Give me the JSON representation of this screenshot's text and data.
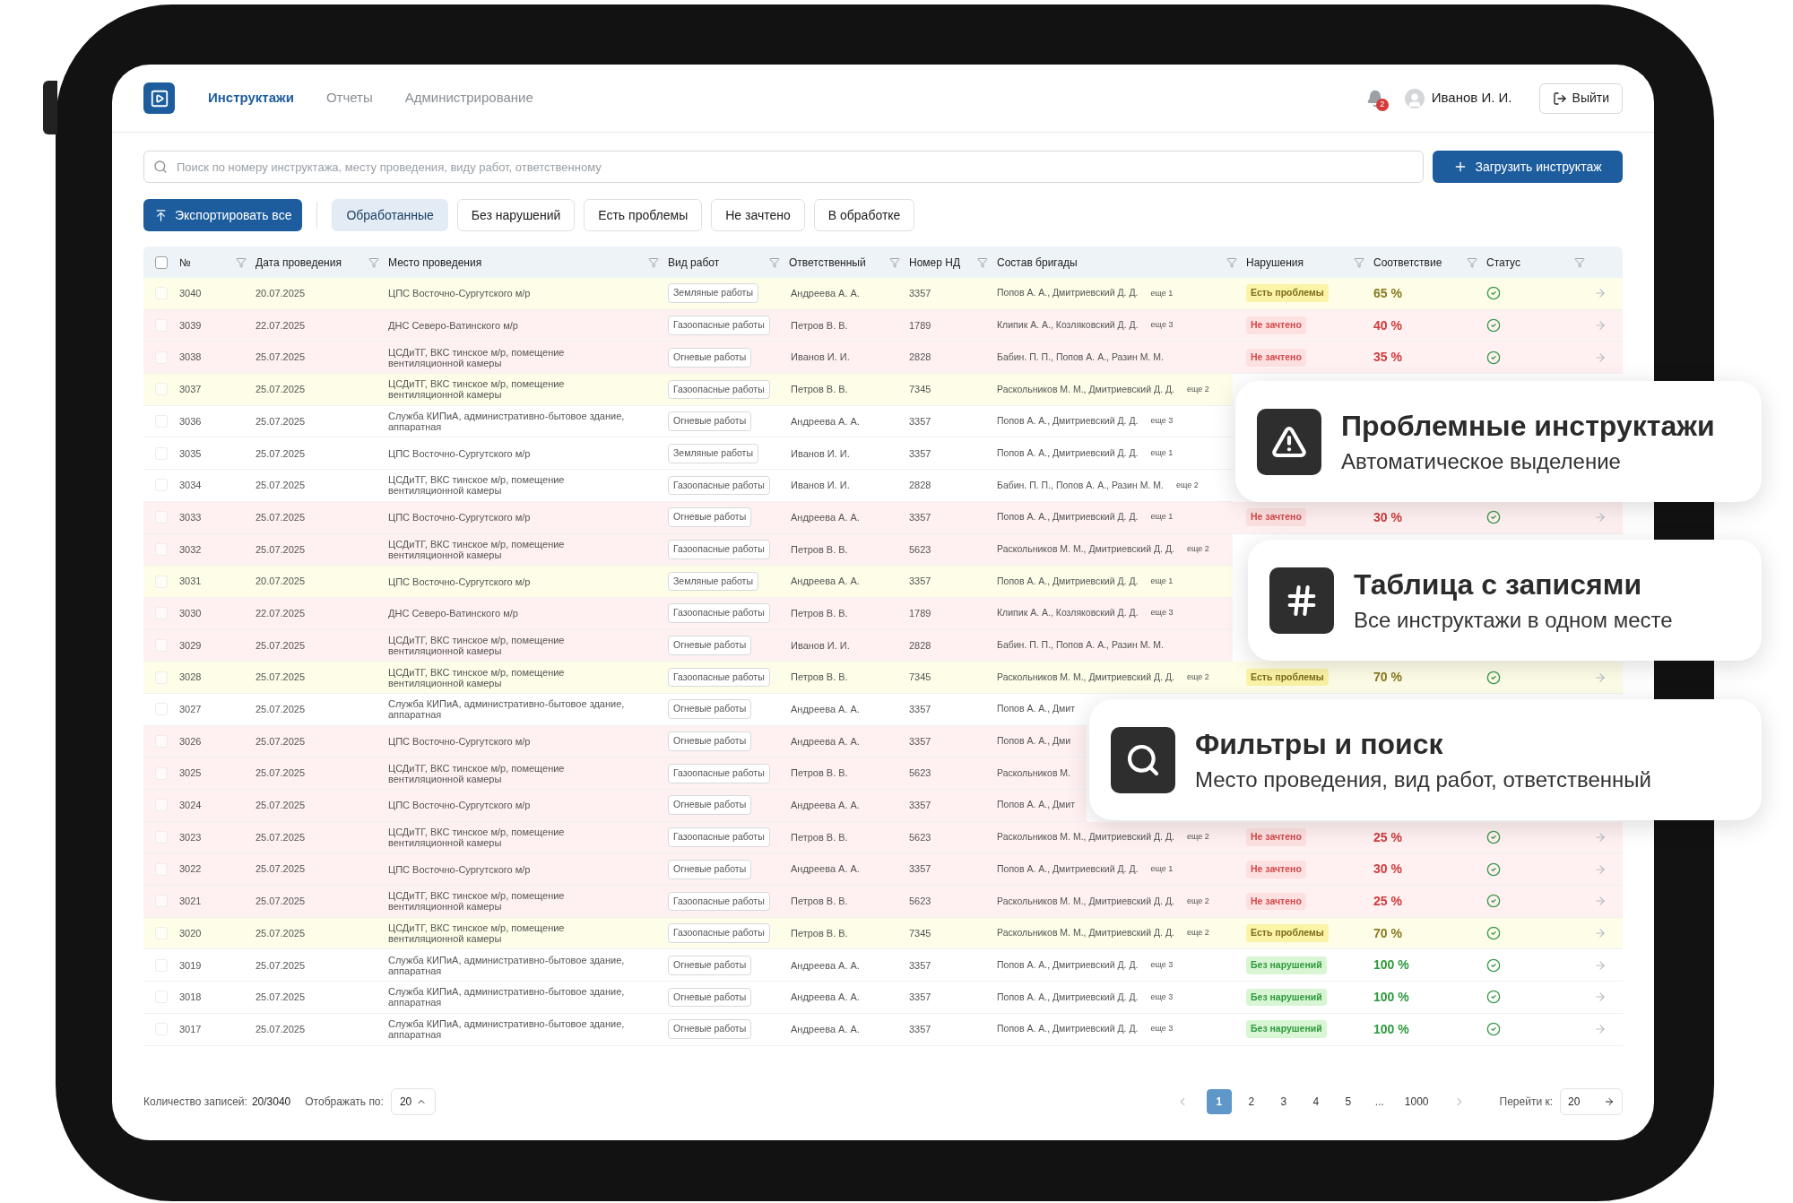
{
  "nav": {
    "tabs": [
      {
        "label": "Инструктажи",
        "selected": true
      },
      {
        "label": "Отчеты",
        "selected": false
      },
      {
        "label": "Администрирование",
        "selected": false
      }
    ]
  },
  "notifications": {
    "count": "2"
  },
  "user": {
    "name": "Иванов И. И."
  },
  "logout_button": "Выйти",
  "search": {
    "placeholder": "Поиск по номеру инструктажа, месту проведения, виду работ, ответственному"
  },
  "upload_button": "Загрузить инструктаж",
  "export_button": "Экспортировать все",
  "filters": [
    {
      "label": "Обработанные",
      "selected": true
    },
    {
      "label": "Без нарушений",
      "selected": false
    },
    {
      "label": "Есть проблемы",
      "selected": false
    },
    {
      "label": "Не зачтено",
      "selected": false
    },
    {
      "label": "В обработке",
      "selected": false
    }
  ],
  "table": {
    "select_all_checked": false,
    "columns": [
      "№",
      "Дата проведения",
      "Место проведения",
      "Вид работ",
      "Ответственный",
      "Номер НД",
      "Состав бригады",
      "Нарушения",
      "Соответствие",
      "Статус"
    ],
    "rows": [
      {
        "n": "3040",
        "date": "20.07.2025",
        "place": "ЦПС Восточно-Сургутского м/р",
        "work": "Земляные работы",
        "resp": "Андреева А. А.",
        "nd": "3357",
        "brigade": "Попов А. А., Дмитриевский Д. Д.",
        "more": "еще 1",
        "kind": "warning",
        "checked": false,
        "violation": {
          "label": "Есть проблемы",
          "kind": "problems"
        },
        "compliance": "65 %",
        "status_ok": true
      },
      {
        "n": "3039",
        "date": "22.07.2025",
        "place": "ДНС Северо-Ватинского м/р",
        "work": "Газоопасные работы",
        "resp": "Петров В. В.",
        "nd": "1789",
        "brigade": "Клипик А. А., Козляковский Д. Д.",
        "more": "еще 3",
        "kind": "danger",
        "checked": false,
        "violation": {
          "label": "Не зачтено",
          "kind": "failed"
        },
        "compliance": "40 %",
        "status_ok": true
      },
      {
        "n": "3038",
        "date": "25.07.2025",
        "place": "ЦСДиТГ, ВКС тинское м/р, помещение вентиляционной камеры",
        "work": "Огневые работы",
        "resp": "Иванов И. И.",
        "nd": "2828",
        "brigade": "Бабин. П. П., Попов А. А., Разин М. М.",
        "kind": "danger",
        "checked": false,
        "violation": {
          "label": "Не зачтено",
          "kind": "failed"
        },
        "compliance": "35 %",
        "status_ok": true
      },
      {
        "n": "3037",
        "date": "25.07.2025",
        "place": "ЦСДиТГ, ВКС тинское м/р, помещение вентиляционной камеры",
        "work": "Газоопасные работы",
        "resp": "Петров В. В.",
        "nd": "7345",
        "brigade": "Раскольников М. М., Дмитриевский Д. Д.",
        "more": "еще 2",
        "kind": "warning",
        "checked": false
      },
      {
        "n": "3036",
        "date": "25.07.2025",
        "place": "Служба КИПиА, административно-бытовое здание, аппаратная",
        "work": "Огневые работы",
        "resp": "Андреева А. А.",
        "nd": "3357",
        "brigade": "Попов А. А., Дмитриевский Д. Д.",
        "more": "еще 3",
        "kind": "none",
        "checked": false
      },
      {
        "n": "3035",
        "date": "25.07.2025",
        "place": "ЦПС Восточно-Сургутского м/р",
        "work": "Земляные работы",
        "resp": "Иванов И. И.",
        "nd": "3357",
        "brigade": "Попов А. А., Дмитриевский Д. Д.",
        "more": "еще 1",
        "kind": "none",
        "checked": false
      },
      {
        "n": "3034",
        "date": "25.07.2025",
        "place": "ЦСДиТГ, ВКС тинское м/р, помещение вентиляционной камеры",
        "work": "Газоопасные работы",
        "resp": "Иванов И. И.",
        "nd": "2828",
        "brigade": "Бабин. П. П., Попов А. А., Разин М. М.",
        "more": "еще 2",
        "kind": "none",
        "checked": false
      },
      {
        "n": "3033",
        "date": "25.07.2025",
        "place": "ЦПС Восточно-Сургутского м/р",
        "work": "Огневые работы",
        "resp": "Андреева А. А.",
        "nd": "3357",
        "brigade": "Попов А. А., Дмитриевский Д. Д.",
        "more": "еще 1",
        "kind": "danger",
        "checked": false,
        "violation": {
          "label": "Не зачтено",
          "kind": "failed"
        },
        "compliance": "30 %",
        "status_ok": true
      },
      {
        "n": "3032",
        "date": "25.07.2025",
        "place": "ЦСДиТГ, ВКС тинское м/р, помещение вентиляционной камеры",
        "work": "Газоопасные работы",
        "resp": "Петров В. В.",
        "nd": "5623",
        "brigade": "Раскольников М. М., Дмитриевский Д. Д.",
        "more": "еще 2",
        "kind": "danger",
        "checked": false
      },
      {
        "n": "3031",
        "date": "20.07.2025",
        "place": "ЦПС Восточно-Сургутского м/р",
        "work": "Земляные работы",
        "resp": "Андреева А. А.",
        "nd": "3357",
        "brigade": "Попов А. А., Дмитриевский Д. Д.",
        "more": "еще 1",
        "kind": "warning",
        "checked": false
      },
      {
        "n": "3030",
        "date": "22.07.2025",
        "place": "ДНС Северо-Ватинского м/р",
        "work": "Газоопасные работы",
        "resp": "Петров В. В.",
        "nd": "1789",
        "brigade": "Клипик А. А., Козляковский Д. Д.",
        "more": "еще 3",
        "kind": "danger",
        "checked": false
      },
      {
        "n": "3029",
        "date": "25.07.2025",
        "place": "ЦСДиТГ, ВКС тинское м/р, помещение вентиляционной камеры",
        "work": "Огневые работы",
        "resp": "Иванов И. И.",
        "nd": "2828",
        "brigade": "Бабин. П. П., Попов А. А., Разин М. М.",
        "kind": "danger",
        "checked": false
      },
      {
        "n": "3028",
        "date": "25.07.2025",
        "place": "ЦСДиТГ, ВКС тинское м/р, помещение вентиляционной камеры",
        "work": "Газоопасные работы",
        "resp": "Петров В. В.",
        "nd": "7345",
        "brigade": "Раскольников М. М., Дмитриевский Д. Д.",
        "more": "еще 2",
        "kind": "warning",
        "checked": false,
        "violation": {
          "label": "Есть проблемы",
          "kind": "problems"
        },
        "compliance": "70 %",
        "status_ok": true
      },
      {
        "n": "3027",
        "date": "25.07.2025",
        "place": "Служба КИПиА, административно-бытовое здание, аппаратная",
        "work": "Огневые работы",
        "resp": "Андреева А. А.",
        "nd": "3357",
        "brigade": "Попов А. А., Дмит",
        "kind": "none",
        "checked": false
      },
      {
        "n": "3026",
        "date": "25.07.2025",
        "place": "ЦПС Восточно-Сургутского м/р",
        "work": "Огневые работы",
        "resp": "Андреева А. А.",
        "nd": "3357",
        "brigade": "Попов А. А., Дми",
        "kind": "danger",
        "checked": false
      },
      {
        "n": "3025",
        "date": "25.07.2025",
        "place": "ЦСДиТГ, ВКС тинское м/р, помещение вентиляционной камеры",
        "work": "Газоопасные работы",
        "resp": "Петров В. В.",
        "nd": "5623",
        "brigade": "Раскольников М.",
        "kind": "danger",
        "checked": false
      },
      {
        "n": "3024",
        "date": "25.07.2025",
        "place": "ЦПС Восточно-Сургутского м/р",
        "work": "Огневые работы",
        "resp": "Андреева А. А.",
        "nd": "3357",
        "brigade": "Попов А. А., Дмит",
        "kind": "danger",
        "checked": false
      },
      {
        "n": "3023",
        "date": "25.07.2025",
        "place": "ЦСДиТГ, ВКС тинское м/р, помещение вентиляционной камеры",
        "work": "Газоопасные работы",
        "resp": "Петров В. В.",
        "nd": "5623",
        "brigade": "Раскольников М. М., Дмитриевский Д. Д.",
        "more": "еще 2",
        "kind": "danger",
        "checked": false,
        "violation": {
          "label": "Не зачтено",
          "kind": "failed"
        },
        "compliance": "25 %",
        "status_ok": true
      },
      {
        "n": "3022",
        "date": "25.07.2025",
        "place": "ЦПС Восточно-Сургутского м/р",
        "work": "Огневые работы",
        "resp": "Андреева А. А.",
        "nd": "3357",
        "brigade": "Попов А. А., Дмитриевский Д. Д.",
        "more": "еще 1",
        "kind": "danger",
        "checked": false,
        "violation": {
          "label": "Не зачтено",
          "kind": "failed"
        },
        "compliance": "30 %",
        "status_ok": true
      },
      {
        "n": "3021",
        "date": "25.07.2025",
        "place": "ЦСДиТГ, ВКС тинское м/р, помещение вентиляционной камеры",
        "work": "Газоопасные работы",
        "resp": "Петров В. В.",
        "nd": "5623",
        "brigade": "Раскольников М. М., Дмитриевский Д. Д.",
        "more": "еще 2",
        "kind": "danger",
        "checked": false,
        "violation": {
          "label": "Не зачтено",
          "kind": "failed"
        },
        "compliance": "25 %",
        "status_ok": true
      },
      {
        "n": "3020",
        "date": "25.07.2025",
        "place": "ЦСДиТГ, ВКС тинское м/р, помещение вентиляционной камеры",
        "work": "Газоопасные работы",
        "resp": "Петров В. В.",
        "nd": "7345",
        "brigade": "Раскольников М. М., Дмитриевский Д. Д.",
        "more": "еще 2",
        "kind": "warning",
        "checked": false,
        "violation": {
          "label": "Есть проблемы",
          "kind": "problems"
        },
        "compliance": "70 %",
        "status_ok": true
      },
      {
        "n": "3019",
        "date": "25.07.2025",
        "place": "Служба КИПиА, административно-бытовое здание, аппаратная",
        "work": "Огневые работы",
        "resp": "Андреева А. А.",
        "nd": "3357",
        "brigade": "Попов А. А., Дмитриевский Д. Д.",
        "more": "еще 3",
        "kind": "none",
        "checked": false,
        "violation": {
          "label": "Без нарушений",
          "kind": "ok"
        },
        "compliance": "100 %",
        "status_ok": true
      },
      {
        "n": "3018",
        "date": "25.07.2025",
        "place": "Служба КИПиА, административно-бытовое здание, аппаратная",
        "work": "Огневые работы",
        "resp": "Андреева А. А.",
        "nd": "3357",
        "brigade": "Попов А. А., Дмитриевский Д. Д.",
        "more": "еще 3",
        "kind": "none",
        "checked": false,
        "violation": {
          "label": "Без нарушений",
          "kind": "ok"
        },
        "compliance": "100 %",
        "status_ok": true
      },
      {
        "n": "3017",
        "date": "25.07.2025",
        "place": "Служба КИПиА, административно-бытовое здание, аппаратная",
        "work": "Огневые работы",
        "resp": "Андреева А. А.",
        "nd": "3357",
        "brigade": "Попов А. А., Дмитриевский Д. Д.",
        "more": "еще 3",
        "kind": "none",
        "checked": false,
        "violation": {
          "label": "Без нарушений",
          "kind": "ok"
        },
        "compliance": "100 %",
        "status_ok": true
      }
    ]
  },
  "footer": {
    "count_label": "Количество записей:",
    "count": "20/3040",
    "per_page_label": "Отображать по:",
    "per_page": "20",
    "pages": [
      {
        "label": "1",
        "kind": "page",
        "selected": true
      },
      {
        "label": "2",
        "kind": "page",
        "selected": false
      },
      {
        "label": "3",
        "kind": "page",
        "selected": false
      },
      {
        "label": "4",
        "kind": "page",
        "selected": false
      },
      {
        "label": "5",
        "kind": "page",
        "selected": false
      },
      {
        "label": "...",
        "kind": "gap"
      },
      {
        "label": "1000",
        "kind": "page",
        "selected": false
      }
    ],
    "goto_label": "Перейти к:",
    "goto_value": "20"
  },
  "feature_cards": [
    {
      "kind": "warning",
      "title": "Проблемные инструктажи",
      "subtitle": "Автоматическое выделение"
    },
    {
      "kind": "table",
      "title": "Таблица с записями",
      "subtitle": "Все инструктажи в одном месте"
    },
    {
      "kind": "search",
      "title": "Фильтры и поиск",
      "subtitle": "Место проведения, вид работ, ответственный"
    }
  ]
}
